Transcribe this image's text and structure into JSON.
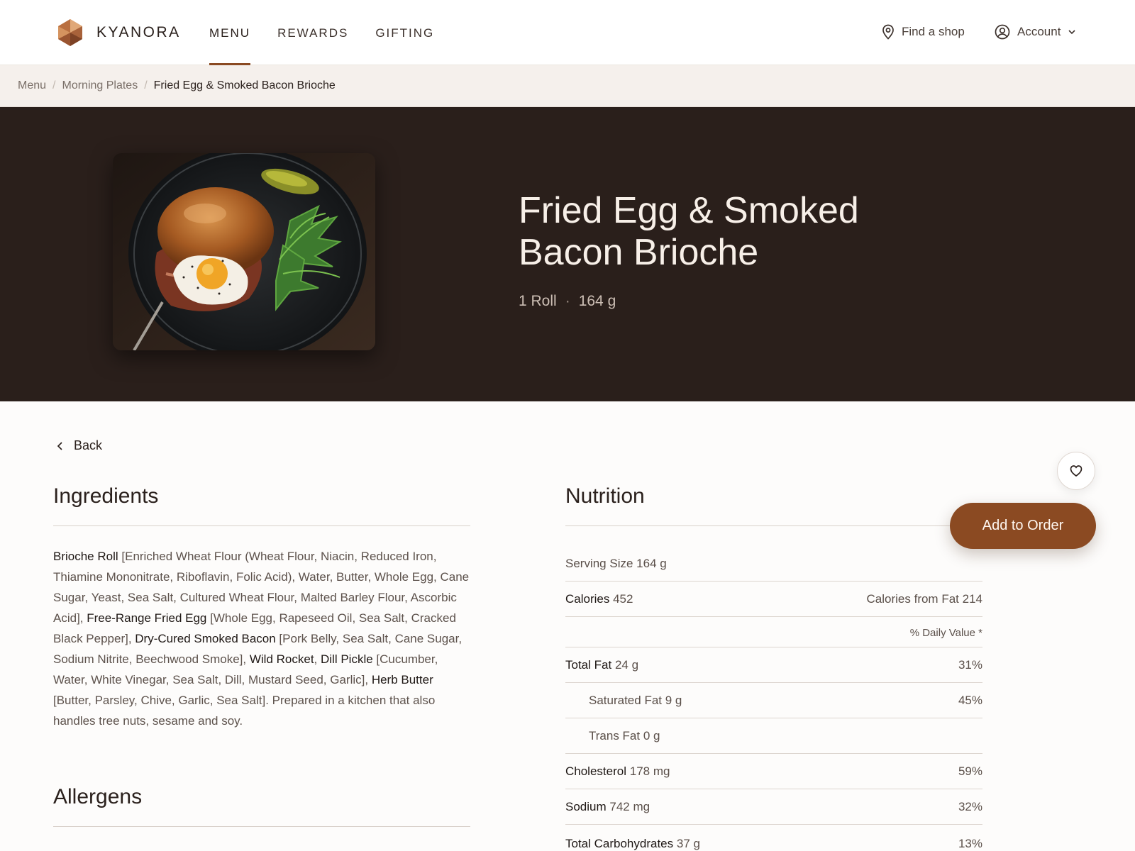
{
  "header": {
    "brand": "KYANORA",
    "nav": [
      "MENU",
      "REWARDS",
      "GIFTING"
    ],
    "find_shop": "Find a shop",
    "account": "Account"
  },
  "breadcrumb": {
    "items": [
      "Menu",
      "Morning Plates",
      "Fried Egg & Smoked Bacon Brioche"
    ]
  },
  "hero": {
    "title": "Fried Egg & Smoked Bacon Brioche",
    "serving": "1 Roll",
    "weight": "164 g"
  },
  "back_label": "Back",
  "ingredients": {
    "heading": "Ingredients",
    "parts": [
      {
        "name": "Brioche Roll",
        "detail": " [Enriched Wheat Flour (Wheat Flour, Niacin, Reduced Iron, Thiamine Mononitrate, Riboflavin, Folic Acid), Water, Butter, Whole Egg, Cane Sugar, Yeast, Sea Salt, Cultured Wheat Flour, Malted Barley Flour, Ascorbic Acid], "
      },
      {
        "name": "Free-Range Fried Egg",
        "detail": " [Whole Egg, Rapeseed Oil, Sea Salt, Cracked Black Pepper], "
      },
      {
        "name": "Dry-Cured Smoked Bacon",
        "detail": " [Pork Belly, Sea Salt, Cane Sugar, Sodium Nitrite, Beechwood Smoke], "
      },
      {
        "name": "Wild Rocket",
        "detail": ", "
      },
      {
        "name": "Dill Pickle",
        "detail": " [Cucumber, Water, White Vinegar, Sea Salt, Dill, Mustard Seed, Garlic], "
      },
      {
        "name": "Herb Butter",
        "detail": " [Butter, Parsley, Chive, Garlic, Sea Salt]. Prepared in a kitchen that also handles tree nuts, sesame and soy."
      }
    ]
  },
  "allergens": {
    "heading": "Allergens"
  },
  "nutrition": {
    "heading": "Nutrition",
    "serving_size_label": "Serving Size",
    "serving_size": "164 g",
    "calories_label": "Calories",
    "calories": "452",
    "calories_from_fat_label": "Calories from Fat",
    "calories_from_fat": "214",
    "daily_value_header": "% Daily Value *",
    "rows": [
      {
        "label": "Total Fat",
        "amount": "24 g",
        "dv": "31%",
        "sub": false
      },
      {
        "label": "Saturated Fat",
        "amount": "9 g",
        "dv": "45%",
        "sub": true
      },
      {
        "label": "Trans Fat",
        "amount": "0 g",
        "dv": "",
        "sub": true
      },
      {
        "label": "Cholesterol",
        "amount": "178 mg",
        "dv": "59%",
        "sub": false
      },
      {
        "label": "Sodium",
        "amount": "742 mg",
        "dv": "32%",
        "sub": false
      },
      {
        "label": "Total Carbohydrates",
        "amount": "37 g",
        "dv": "13%",
        "sub": false
      }
    ]
  },
  "actions": {
    "add_to_order": "Add to Order",
    "favorite_icon": "heart-icon"
  },
  "colors": {
    "accent": "#8b4a22",
    "hero_bg": "#2a1f1b",
    "crumb_bg": "#f5f0ec"
  }
}
